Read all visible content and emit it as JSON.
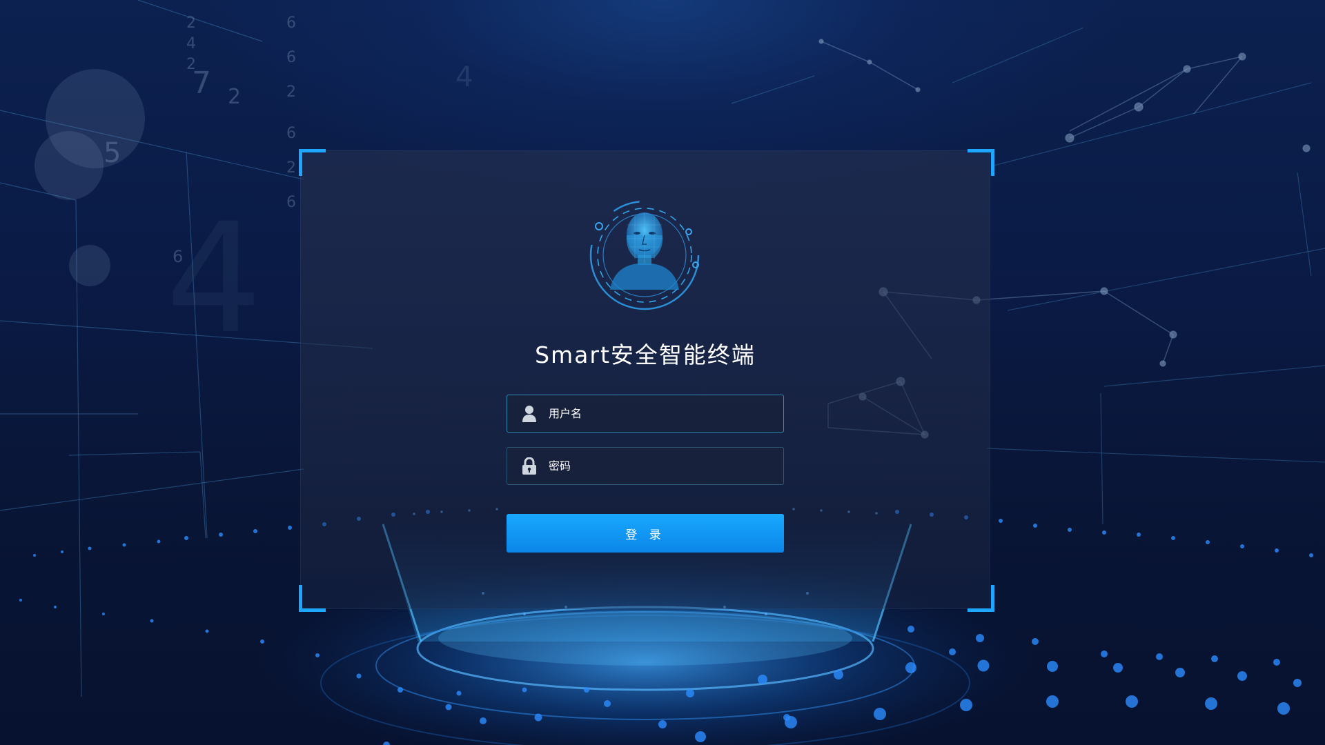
{
  "login": {
    "title": "Smart安全智能终端",
    "username_placeholder": "用户名",
    "password_placeholder": "密码",
    "submit_label": "登 录"
  },
  "icons": {
    "avatar": "face-scan-icon",
    "username": "user-icon",
    "password": "lock-icon"
  },
  "colors": {
    "background": "#0a1838",
    "accent": "#1fa7ff",
    "button": "#0b86e8",
    "panel": "#222c48",
    "text": "#ffffff"
  }
}
